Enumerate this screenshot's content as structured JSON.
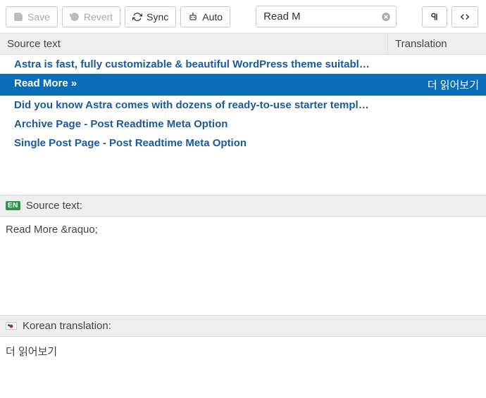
{
  "toolbar": {
    "save_label": "Save",
    "revert_label": "Revert",
    "sync_label": "Sync",
    "auto_label": "Auto"
  },
  "search": {
    "value": "Read M"
  },
  "table": {
    "header_source": "Source text",
    "header_translation": "Translation",
    "rows": [
      {
        "source": "Astra is fast, fully customizable & beautiful WordPress theme suitable for …",
        "translation": "",
        "selected": false
      },
      {
        "source": "Read More »",
        "translation": "더 읽어보기",
        "selected": true
      },
      {
        "source": "Did you know Astra comes with dozens of ready-to-use starter templates? I…",
        "translation": "",
        "selected": false
      },
      {
        "source": "Archive Page - Post Readtime Meta Option",
        "translation": "",
        "selected": false
      },
      {
        "source": "Single Post Page - Post Readtime Meta Option",
        "translation": "",
        "selected": false
      }
    ]
  },
  "editor": {
    "source_header": "Source text:",
    "source_lang_badge": "EN",
    "source_value": "Read More &raquo;",
    "translation_header": "Korean translation:",
    "translation_value": "더 읽어보기"
  }
}
